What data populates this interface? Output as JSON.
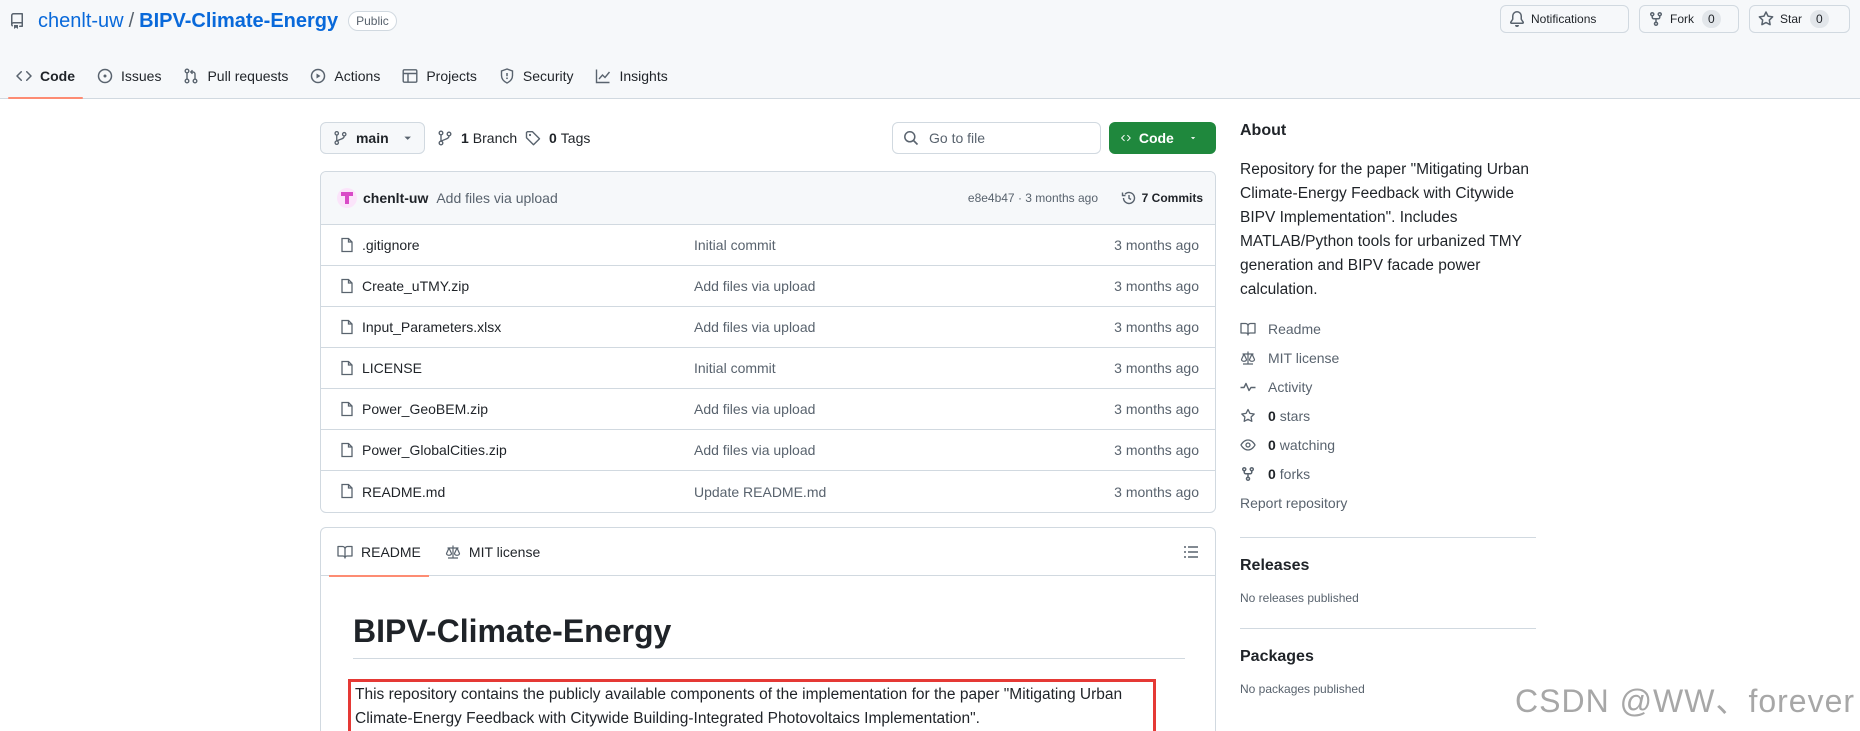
{
  "repo": {
    "owner": "chenlt-uw",
    "separator": "/",
    "name": "BIPV-Climate-Energy",
    "visibility": "Public"
  },
  "header_actions": {
    "notifications_label": "Notifications",
    "fork_label": "Fork",
    "fork_count": "0",
    "star_label": "Star",
    "star_count": "0"
  },
  "tabs": [
    {
      "label": "Code",
      "icon": "code-icon",
      "active": true
    },
    {
      "label": "Issues",
      "icon": "issue-icon"
    },
    {
      "label": "Pull requests",
      "icon": "pull-request-icon"
    },
    {
      "label": "Actions",
      "icon": "play-icon"
    },
    {
      "label": "Projects",
      "icon": "table-icon"
    },
    {
      "label": "Security",
      "icon": "shield-icon"
    },
    {
      "label": "Insights",
      "icon": "graph-icon"
    }
  ],
  "toolbar": {
    "branch_name": "main",
    "branch_count": "1",
    "branch_label": "Branch",
    "tag_count": "0",
    "tag_label": "Tags",
    "go_to_file_placeholder": "Go to file",
    "code_button_label": "Code"
  },
  "latest_commit": {
    "author": "chenlt-uw",
    "message": "Add files via upload",
    "hash_and_time": "e8e4b47 · 3 months ago",
    "commits_label": "7 Commits"
  },
  "files": [
    {
      "name": ".gitignore",
      "commit": "Initial commit",
      "date": "3 months ago"
    },
    {
      "name": "Create_uTMY.zip",
      "commit": "Add files via upload",
      "date": "3 months ago"
    },
    {
      "name": "Input_Parameters.xlsx",
      "commit": "Add files via upload",
      "date": "3 months ago"
    },
    {
      "name": "LICENSE",
      "commit": "Initial commit",
      "date": "3 months ago"
    },
    {
      "name": "Power_GeoBEM.zip",
      "commit": "Add files via upload",
      "date": "3 months ago"
    },
    {
      "name": "Power_GlobalCities.zip",
      "commit": "Add files via upload",
      "date": "3 months ago"
    },
    {
      "name": "README.md",
      "commit": "Update README.md",
      "date": "3 months ago"
    }
  ],
  "readme": {
    "tab_readme": "README",
    "tab_license": "MIT license",
    "heading": "BIPV-Climate-Energy",
    "paragraph": "This repository contains the publicly available components of the implementation for the paper \"Mitigating Urban Climate-Energy Feedback with Citywide Building-Integrated Photovoltaics Implementation\".",
    "highlight_color": "#e53935"
  },
  "about": {
    "title": "About",
    "description": "Repository for the paper \"Mitigating Urban Climate-Energy Feedback with Citywide BIPV Implementation\". Includes MATLAB/Python tools for urbanized TMY generation and BIPV facade power calculation.",
    "readme_label": "Readme",
    "license_label": "MIT license",
    "activity_label": "Activity",
    "stars_count": "0",
    "stars_label": "stars",
    "watching_count": "0",
    "watching_label": "watching",
    "forks_count": "0",
    "forks_label": "forks",
    "report_label": "Report repository"
  },
  "releases": {
    "title": "Releases",
    "empty": "No releases published"
  },
  "packages": {
    "title": "Packages",
    "empty": "No packages published"
  },
  "watermark": "CSDN @WW、forever",
  "colors": {
    "accent_blue": "#0969da",
    "green_button": "#1f883d",
    "tab_underline": "#fd8c73"
  }
}
